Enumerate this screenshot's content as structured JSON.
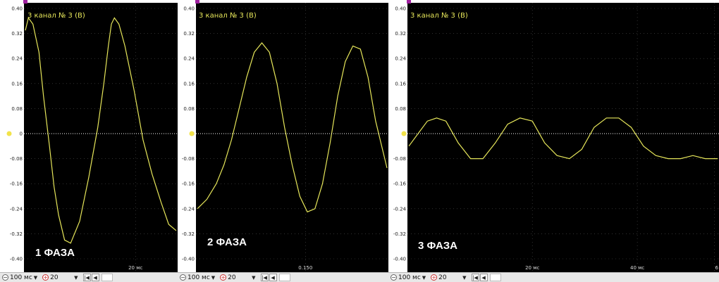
{
  "panels": [
    {
      "id": "phase1",
      "channel_title": "3  канал № 3 (В)",
      "phase_label": "1 ФАЗА",
      "y_ticks": [
        "0.40",
        "0.32",
        "0.24",
        "0.16",
        "0.08",
        "0",
        "-0.08",
        "-0.16",
        "-0.24",
        "-0.32",
        "-0.40"
      ],
      "x_ticks": [
        "20 мс"
      ]
    },
    {
      "id": "phase2",
      "channel_title": "3  канал № 3 (В)",
      "phase_label": "2 ФАЗА",
      "y_ticks": [
        "0.40",
        "0.32",
        "0.24",
        "0.16",
        "0.08",
        "0",
        "-0.08",
        "-0.16",
        "-0.24",
        "-0.32",
        "-0.40"
      ],
      "x_ticks": [
        "0.150"
      ]
    },
    {
      "id": "phase3",
      "channel_title": "3  канал № 3 (В)",
      "phase_label": "3 ФАЗА",
      "y_ticks": [
        "0.40",
        "0.32",
        "0.24",
        "0.16",
        "0.08",
        "0",
        "-0.08",
        "-0.16",
        "-0.24",
        "-0.32",
        "-0.40"
      ],
      "x_ticks": [
        "20 мс",
        "40 мс",
        "6"
      ]
    }
  ],
  "toolbars": [
    {
      "time_scale": "100 мс",
      "amp_scale": "20"
    },
    {
      "time_scale": "100 мс",
      "amp_scale": "20"
    },
    {
      "time_scale": "100 мс",
      "amp_scale": "20"
    }
  ],
  "colors": {
    "trace": "#e6e65a",
    "zero_marker": "#f2e34a",
    "cursor_marker": "#a020a0",
    "grid": "#505050",
    "background": "#000000"
  },
  "chart_data": [
    {
      "type": "line",
      "title": "3  канал № 3 (В)",
      "ylim": [
        -0.4,
        0.4
      ],
      "series": [
        {
          "x": [
            0.0,
            0.02,
            0.05,
            0.09,
            0.12,
            0.16,
            0.19,
            0.22,
            0.26,
            0.3,
            0.36,
            0.42,
            0.48,
            0.52,
            0.55,
            0.57,
            0.59,
            0.62,
            0.66,
            0.72,
            0.78,
            0.84,
            0.9,
            0.95,
            1.0
          ],
          "values": [
            0.33,
            0.37,
            0.35,
            0.26,
            0.12,
            -0.04,
            -0.17,
            -0.26,
            -0.34,
            -0.35,
            -0.28,
            -0.14,
            0.02,
            0.16,
            0.28,
            0.35,
            0.37,
            0.35,
            0.28,
            0.14,
            -0.02,
            -0.13,
            -0.22,
            -0.29,
            -0.31
          ]
        }
      ]
    },
    {
      "type": "line",
      "title": "3  канал № 3 (В)",
      "ylim": [
        -0.4,
        0.4
      ],
      "series": [
        {
          "x": [
            0.0,
            0.05,
            0.1,
            0.14,
            0.18,
            0.22,
            0.26,
            0.3,
            0.34,
            0.38,
            0.42,
            0.46,
            0.5,
            0.54,
            0.58,
            0.62,
            0.66,
            0.7,
            0.74,
            0.78,
            0.82,
            0.86,
            0.9,
            0.94,
            1.0
          ],
          "values": [
            -0.24,
            -0.21,
            -0.16,
            -0.1,
            -0.02,
            0.08,
            0.18,
            0.26,
            0.29,
            0.26,
            0.16,
            0.02,
            -0.1,
            -0.2,
            -0.25,
            -0.24,
            -0.16,
            -0.03,
            0.12,
            0.23,
            0.28,
            0.27,
            0.18,
            0.04,
            -0.11
          ]
        }
      ]
    },
    {
      "type": "line",
      "title": "3  канал № 3 (В)",
      "ylim": [
        -0.4,
        0.4
      ],
      "x_ticks": [
        "20 мс",
        "40 мс"
      ],
      "series": [
        {
          "x": [
            0.0,
            0.03,
            0.06,
            0.09,
            0.12,
            0.16,
            0.2,
            0.24,
            0.28,
            0.32,
            0.36,
            0.4,
            0.44,
            0.48,
            0.52,
            0.56,
            0.6,
            0.64,
            0.68,
            0.72,
            0.76,
            0.8,
            0.84,
            0.88,
            0.92,
            0.96,
            1.0
          ],
          "values": [
            -0.04,
            0.0,
            0.04,
            0.05,
            0.04,
            -0.03,
            -0.08,
            -0.08,
            -0.03,
            0.03,
            0.05,
            0.04,
            -0.03,
            -0.07,
            -0.08,
            -0.05,
            0.02,
            0.05,
            0.05,
            0.02,
            -0.04,
            -0.07,
            -0.08,
            -0.08,
            -0.07,
            -0.08,
            -0.08
          ]
        }
      ]
    }
  ]
}
